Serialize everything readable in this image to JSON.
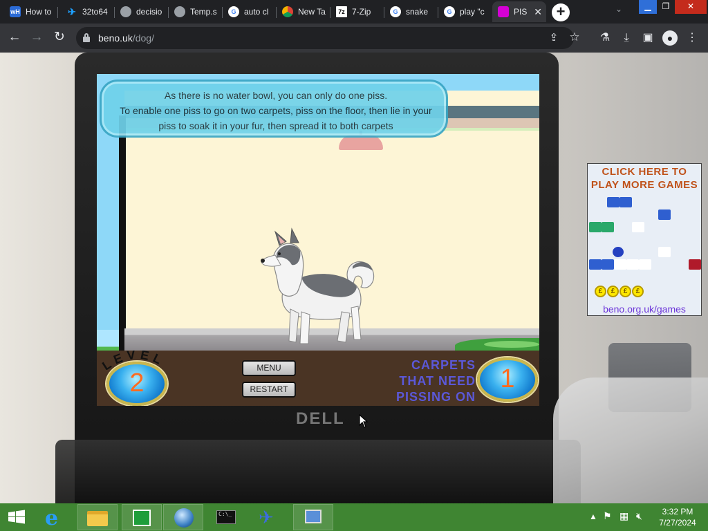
{
  "browser": {
    "tabs": [
      {
        "label": "How to",
        "icon": "wikihow-icon",
        "color": "#2b6bd6"
      },
      {
        "label": "32to64",
        "icon": "bird-icon",
        "color": "#1ea0ff"
      },
      {
        "label": "decisio",
        "icon": "globe-icon",
        "color": "#9aa0a6"
      },
      {
        "label": "Temp.s",
        "icon": "globe-icon",
        "color": "#9aa0a6"
      },
      {
        "label": "auto cl",
        "icon": "google-icon",
        "color": "#ffffff"
      },
      {
        "label": "New Ta",
        "icon": "chrome-icon",
        "color": "#ffffff"
      },
      {
        "label": "7-Zip",
        "icon": "7zip-icon",
        "color": "#ffffff"
      },
      {
        "label": "snake",
        "icon": "google-icon",
        "color": "#ffffff"
      },
      {
        "label": "play \"c",
        "icon": "google-icon",
        "color": "#ffffff"
      },
      {
        "label": "PIS",
        "icon": "game-icon",
        "color": "#d400d4",
        "active": true
      }
    ],
    "address": {
      "domain": "beno.uk",
      "path": "/dog/"
    }
  },
  "game": {
    "message_line1": "As there is no water bowl, you can only do one piss.",
    "message_line2": "To enable one piss to go on two carpets, piss on the floor, then lie in your piss to soak it in your fur, then spread it to both carpets",
    "level_label": "LEVEL",
    "level_value": "2",
    "menu_label": "MENU",
    "restart_label": "RESTART",
    "carpets_label_1": "CARPETS",
    "carpets_label_2": "THAT NEED",
    "carpets_label_3": "PISSING ON",
    "carpets_value": "1"
  },
  "ad": {
    "title_line1": "CLICK HERE TO",
    "title_line2": "PLAY MORE GAMES",
    "url": "beno.org.uk/games",
    "coin_symbol": "£"
  },
  "monitor_brand": "DELL",
  "taskbar": {
    "time": "3:32 PM",
    "date": "7/27/2024"
  },
  "colors": {
    "taskbar": "#3f8532",
    "chrome_dark": "#202124",
    "carpets_text": "#5b58d8",
    "level_number": "#ff6b1f"
  }
}
